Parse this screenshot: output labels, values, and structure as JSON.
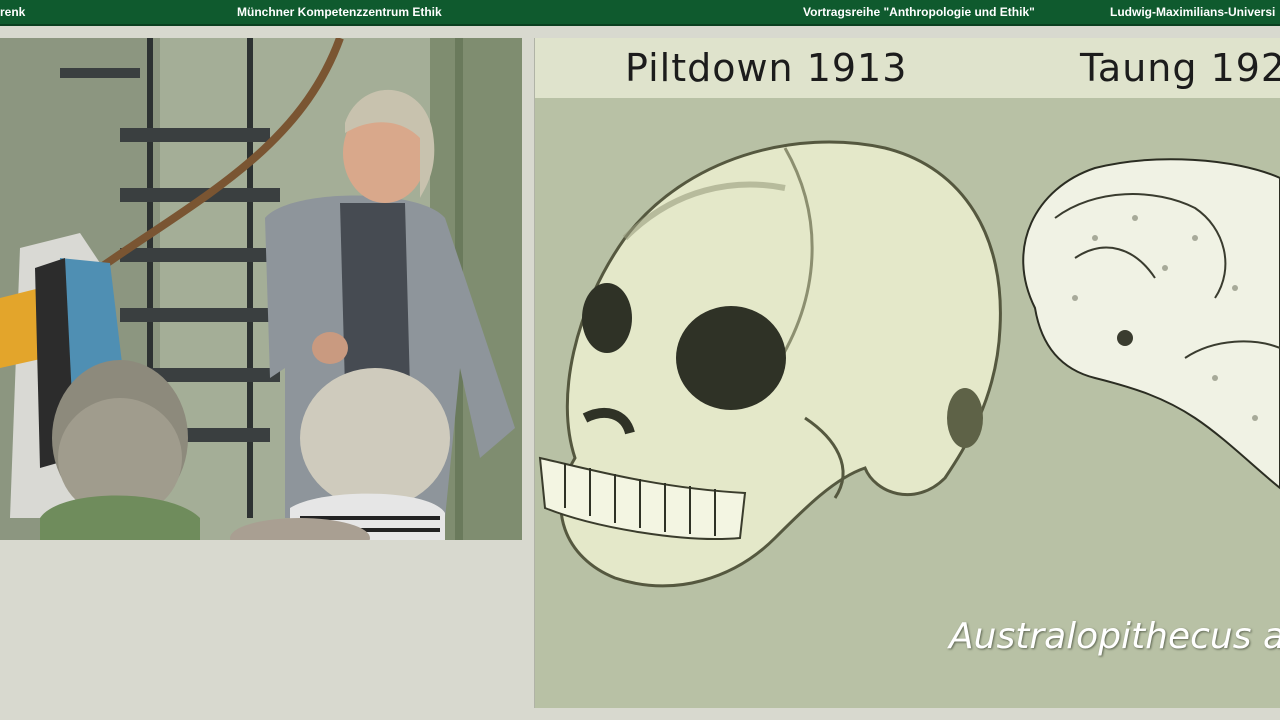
{
  "banner": {
    "left_text": "renk",
    "center_text": "Münchner Kompetenzzentrum Ethik",
    "series_text": "Vortragsreihe \"Anthropologie und Ethik\"",
    "right_text": "Ludwig-Maximilians-Universi"
  },
  "slide": {
    "title_left": "Piltdown 1913",
    "title_right": "Taung 192",
    "caption": "Australopithecus afr"
  },
  "colors": {
    "banner_bg": "#0f5a2e",
    "slide_bg": "#b8c1a5",
    "slide_header_bg": "#dfe3cc",
    "page_bg": "#d8d9cf"
  }
}
